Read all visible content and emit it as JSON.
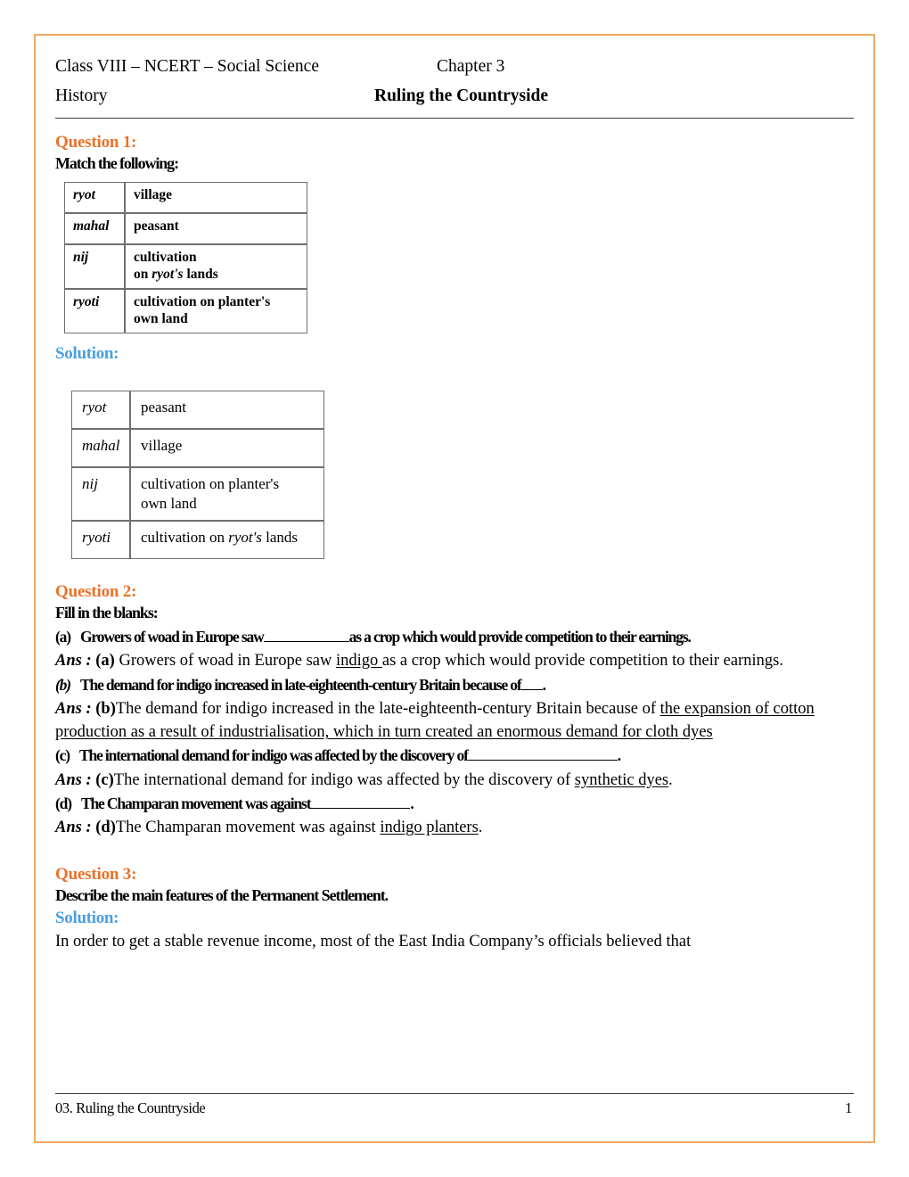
{
  "page": {
    "border_color": "#F0A864",
    "accent_question_color": "#E8722A",
    "accent_solution_color": "#4A9FE0"
  },
  "header": {
    "left_line1": "Class VIII – NCERT – Social Science",
    "right_line1": "Chapter 3",
    "left_line2": "History",
    "right_line2": "Ruling the Countryside"
  },
  "question1": {
    "heading": "Question 1:",
    "prompt": "Match the following:",
    "table": {
      "rows": [
        {
          "term": "ryot",
          "desc": "village"
        },
        {
          "term": "mahal",
          "desc": "peasant"
        },
        {
          "term": "nij",
          "desc_line1": "cultivation",
          "desc_line2_pre": "on ",
          "desc_line2_italic": "ryot's",
          "desc_line2_post": " lands"
        },
        {
          "term": "ryoti",
          "desc_line1": "cultivation on planter's",
          "desc_line2": "own land"
        }
      ]
    },
    "solution_label": "Solution:",
    "solution_table": {
      "rows": [
        {
          "term": "ryot",
          "desc": "peasant"
        },
        {
          "term": "mahal",
          "desc": "village"
        },
        {
          "term": "nij",
          "desc_line1": "cultivation on planter's",
          "desc_line2": "own land"
        },
        {
          "term": "ryoti",
          "desc_pre": "cultivation on ",
          "desc_italic": "ryot's",
          "desc_post": " lands"
        }
      ]
    }
  },
  "question2": {
    "heading": "Question 2:",
    "prompt": "Fill in the blanks:",
    "items": [
      {
        "label": "(a)",
        "q_pre": "Growers of woad in Europe saw",
        "q_post": "as a crop which would provide competition to their earnings.",
        "ans_label": "Ans :",
        "ans_bold": "(a)",
        "ans_pre": " Growers of woad in Europe saw ",
        "ans_underlined": "indigo ",
        "ans_post": "as a crop which would provide competition to their earnings."
      },
      {
        "label": "(b)",
        "q_pre": "The demand for indigo increased in late-eighteenth-century Britain because of",
        "q_post": ".",
        "ans_label": "Ans :",
        "ans_bold": "(b)",
        "ans_pre": "The demand for indigo increased in the late-eighteenth-century Britain because   of ",
        "ans_underlined": "the expansion of cotton production as a result of industrialisation, which in turn created an enormous demand for cloth  dyes",
        "ans_post": ""
      },
      {
        "label": "(c)",
        "q_pre": "The international demand for indigo was affected by the discovery of",
        "q_post": ".",
        "ans_label": "Ans :",
        "ans_bold": "(c)",
        "ans_pre": "The international demand for indigo was affected by the discovery of ",
        "ans_underlined": "synthetic  dyes",
        "ans_post": "."
      },
      {
        "label": "(d)",
        "q_pre": "The Champaran movement was against",
        "q_post": ".",
        "ans_label": "Ans :",
        "ans_bold": "(d)",
        "ans_pre": "The Champaran movement was against ",
        "ans_underlined": "indigo planters",
        "ans_post": "."
      }
    ]
  },
  "question3": {
    "heading": "Question 3:",
    "prompt": "Describe the main features of the Permanent Settlement.",
    "solution_label": "Solution:",
    "body": " In order to get a stable revenue income, most of the East India Company’s officials believed that"
  },
  "footer": {
    "left": "03. Ruling the Countryside",
    "page_number": "1"
  }
}
